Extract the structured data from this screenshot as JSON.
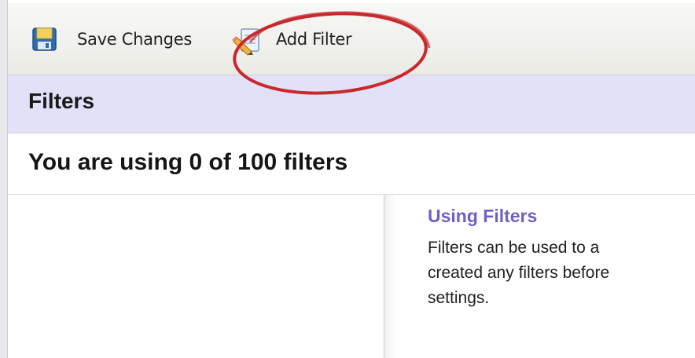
{
  "toolbar": {
    "save_label": "Save Changes",
    "save_icon": "floppy-disk-icon",
    "add_filter_label": "Add Filter",
    "add_filter_icon": "pencil-note-icon",
    "annotation_color": "#c8282e"
  },
  "header": {
    "title": "Filters",
    "background": "#e1e1f7"
  },
  "usage": {
    "text": "You are using 0 of 100 filters"
  },
  "help": {
    "heading": "Using Filters",
    "heading_color": "#6d62c2",
    "lines": [
      "Filters can be used to a",
      "created any filters before",
      "settings."
    ]
  }
}
